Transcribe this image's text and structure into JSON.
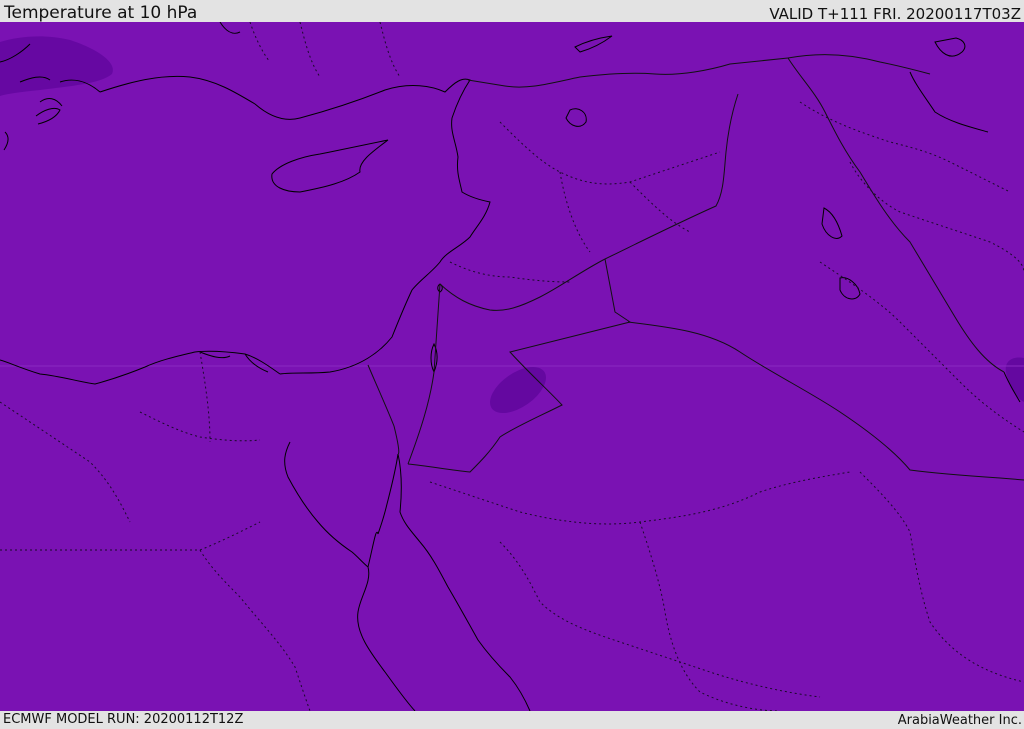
{
  "header": {
    "title": "Temperature at 10 hPa",
    "valid_time": "VALID T+111 FRI. 20200117T03Z"
  },
  "footer": {
    "model_run": "ECMWF MODEL RUN: 20200112T12Z",
    "credit": "ArabiaWeather Inc."
  },
  "map": {
    "fill_color": "#7a12b3",
    "dark_patch_color": "#5e0a92",
    "coast_color": "#000000",
    "border_color": "#1a0a2a"
  }
}
